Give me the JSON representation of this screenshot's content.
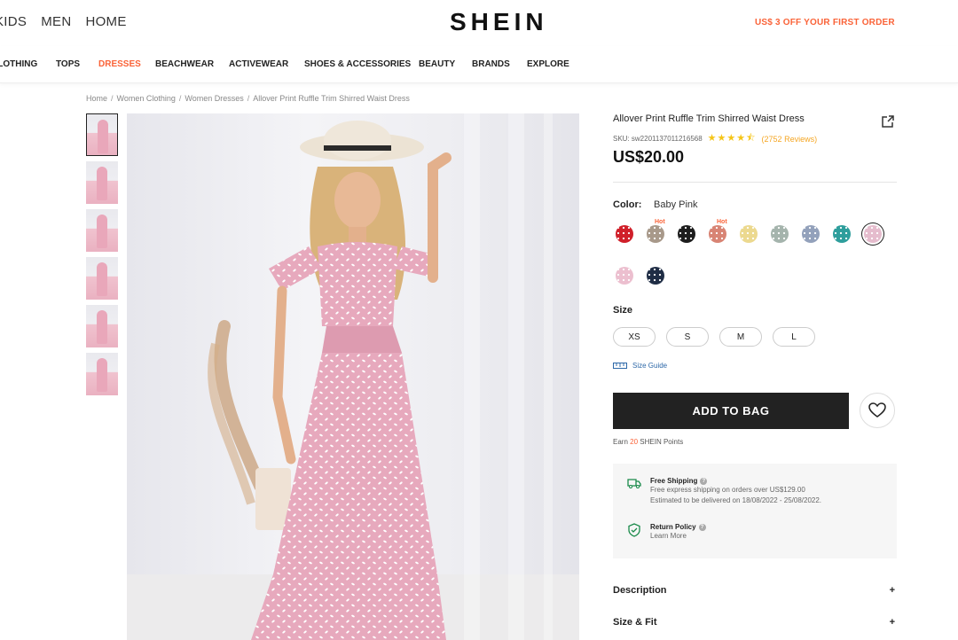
{
  "header": {
    "nav": [
      "KIDS",
      "MEN",
      "HOME"
    ],
    "logo": "SHEIN",
    "promo": "US$ 3 OFF YOUR FIRST ORDER"
  },
  "categories": [
    "CLOTHING",
    "TOPS",
    "DRESSES",
    "BEACHWEAR",
    "ACTIVEWEAR",
    "SHOES & ACCESSORIES",
    "BEAUTY",
    "BRANDS",
    "EXPLORE"
  ],
  "active_category": "DRESSES",
  "breadcrumb": [
    "Home",
    "Women Clothing",
    "Women Dresses",
    "Allover Print Ruffle Trim Shirred Waist Dress"
  ],
  "product": {
    "title": "Allover Print Ruffle Trim Shirred Waist Dress",
    "sku": "SKU: sw2201137011216568",
    "rating": 4.5,
    "reviews": "(2752 Reviews)",
    "price": "US$20.00"
  },
  "color": {
    "label": "Color:",
    "value": "Baby Pink",
    "swatches": [
      {
        "name": "red",
        "hex": "#d0202a",
        "hot": false
      },
      {
        "name": "khaki",
        "hex": "#a8998a",
        "hot": true
      },
      {
        "name": "black",
        "hex": "#1d1d1d",
        "hot": false
      },
      {
        "name": "coral",
        "hex": "#d88474",
        "hot": true
      },
      {
        "name": "yellow",
        "hex": "#ecd98f",
        "hot": false
      },
      {
        "name": "sage",
        "hex": "#a5b4ad",
        "hot": false
      },
      {
        "name": "dusty-blue",
        "hex": "#93a1bb",
        "hot": false
      },
      {
        "name": "teal",
        "hex": "#2e9e9c",
        "hot": false
      },
      {
        "name": "baby-pink",
        "hex": "#e5bccd",
        "hot": false,
        "selected": true
      },
      {
        "name": "light-pink",
        "hex": "#ecbfcf",
        "hot": false
      },
      {
        "name": "navy",
        "hex": "#1f2d45",
        "hot": false
      }
    ],
    "hot_label": "Hot"
  },
  "size": {
    "label": "Size",
    "options": [
      "XS",
      "S",
      "M",
      "L"
    ],
    "guide": "Size Guide"
  },
  "actions": {
    "add_to_bag": "ADD TO BAG",
    "earn_prefix": "Earn",
    "earn_points": "20",
    "earn_suffix": "SHEIN Points"
  },
  "shipping": {
    "title": "Free Shipping",
    "line1": "Free express shipping on orders over US$129.00",
    "line2": "Estimated to be delivered on 18/08/2022 - 25/08/2022."
  },
  "returns": {
    "title": "Return Policy",
    "link": "Learn More"
  },
  "accordions": [
    "Description",
    "Size & Fit"
  ],
  "colors": {
    "accent": "#fa6338",
    "dark": "#222222",
    "link": "#2d68a8"
  }
}
